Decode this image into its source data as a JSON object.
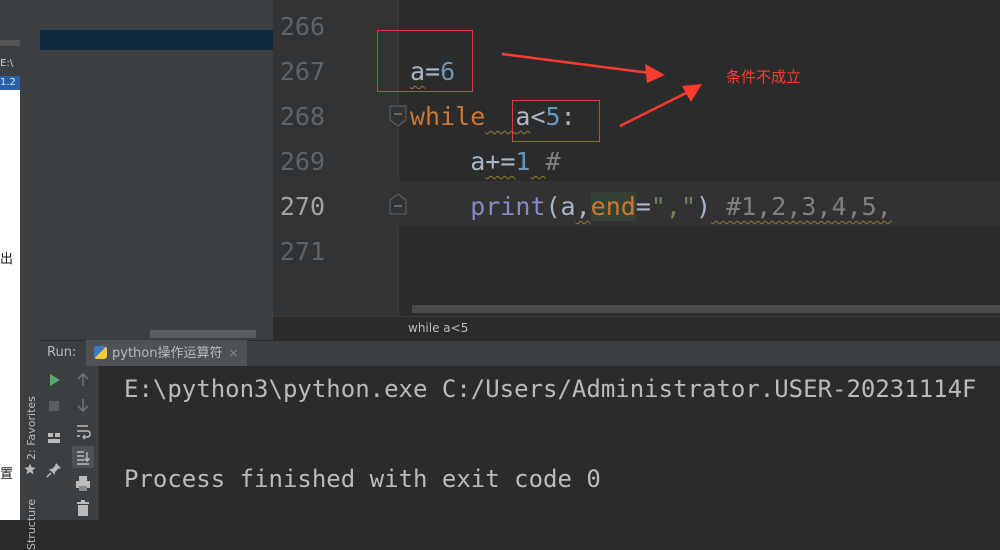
{
  "left_window": {
    "path_fragment": "E:\\",
    "line_fragment": "1.2",
    "edge_char_1": "出",
    "edge_char_2": "置"
  },
  "editor": {
    "lines": [
      {
        "number": "266",
        "code": ""
      },
      {
        "number": "267",
        "code": "a=6"
      },
      {
        "number": "268",
        "code": "while  a<5:"
      },
      {
        "number": "269",
        "code": "    a+=1 #"
      },
      {
        "number": "270",
        "code": "    print(a,end=\",\") #1,2,3,4,5,"
      },
      {
        "number": "271",
        "code": ""
      }
    ],
    "current_line": "270",
    "breadcrumb": "while a<5"
  },
  "annotation": {
    "text": "条件不成立",
    "color": "#ff3b30"
  },
  "run_panel": {
    "label": "Run:",
    "tab_label": "python操作运算符",
    "tab_close": "×",
    "console": [
      "E:\\python3\\python.exe C:/Users/Administrator.USER-20231114F",
      "",
      "Process finished with exit code 0"
    ]
  },
  "side_strip": {
    "favorites": "2: Favorites",
    "structure": "Structure"
  },
  "toolbar_icons": {
    "run": "run-icon",
    "stop": "stop-icon",
    "layout": "layout-icon",
    "pin": "pin-icon",
    "up": "arrow-up-icon",
    "down": "arrow-down-icon",
    "wrap": "soft-wrap-icon",
    "scroll_end": "scroll-to-end-icon",
    "print": "print-icon",
    "trash": "trash-icon"
  }
}
